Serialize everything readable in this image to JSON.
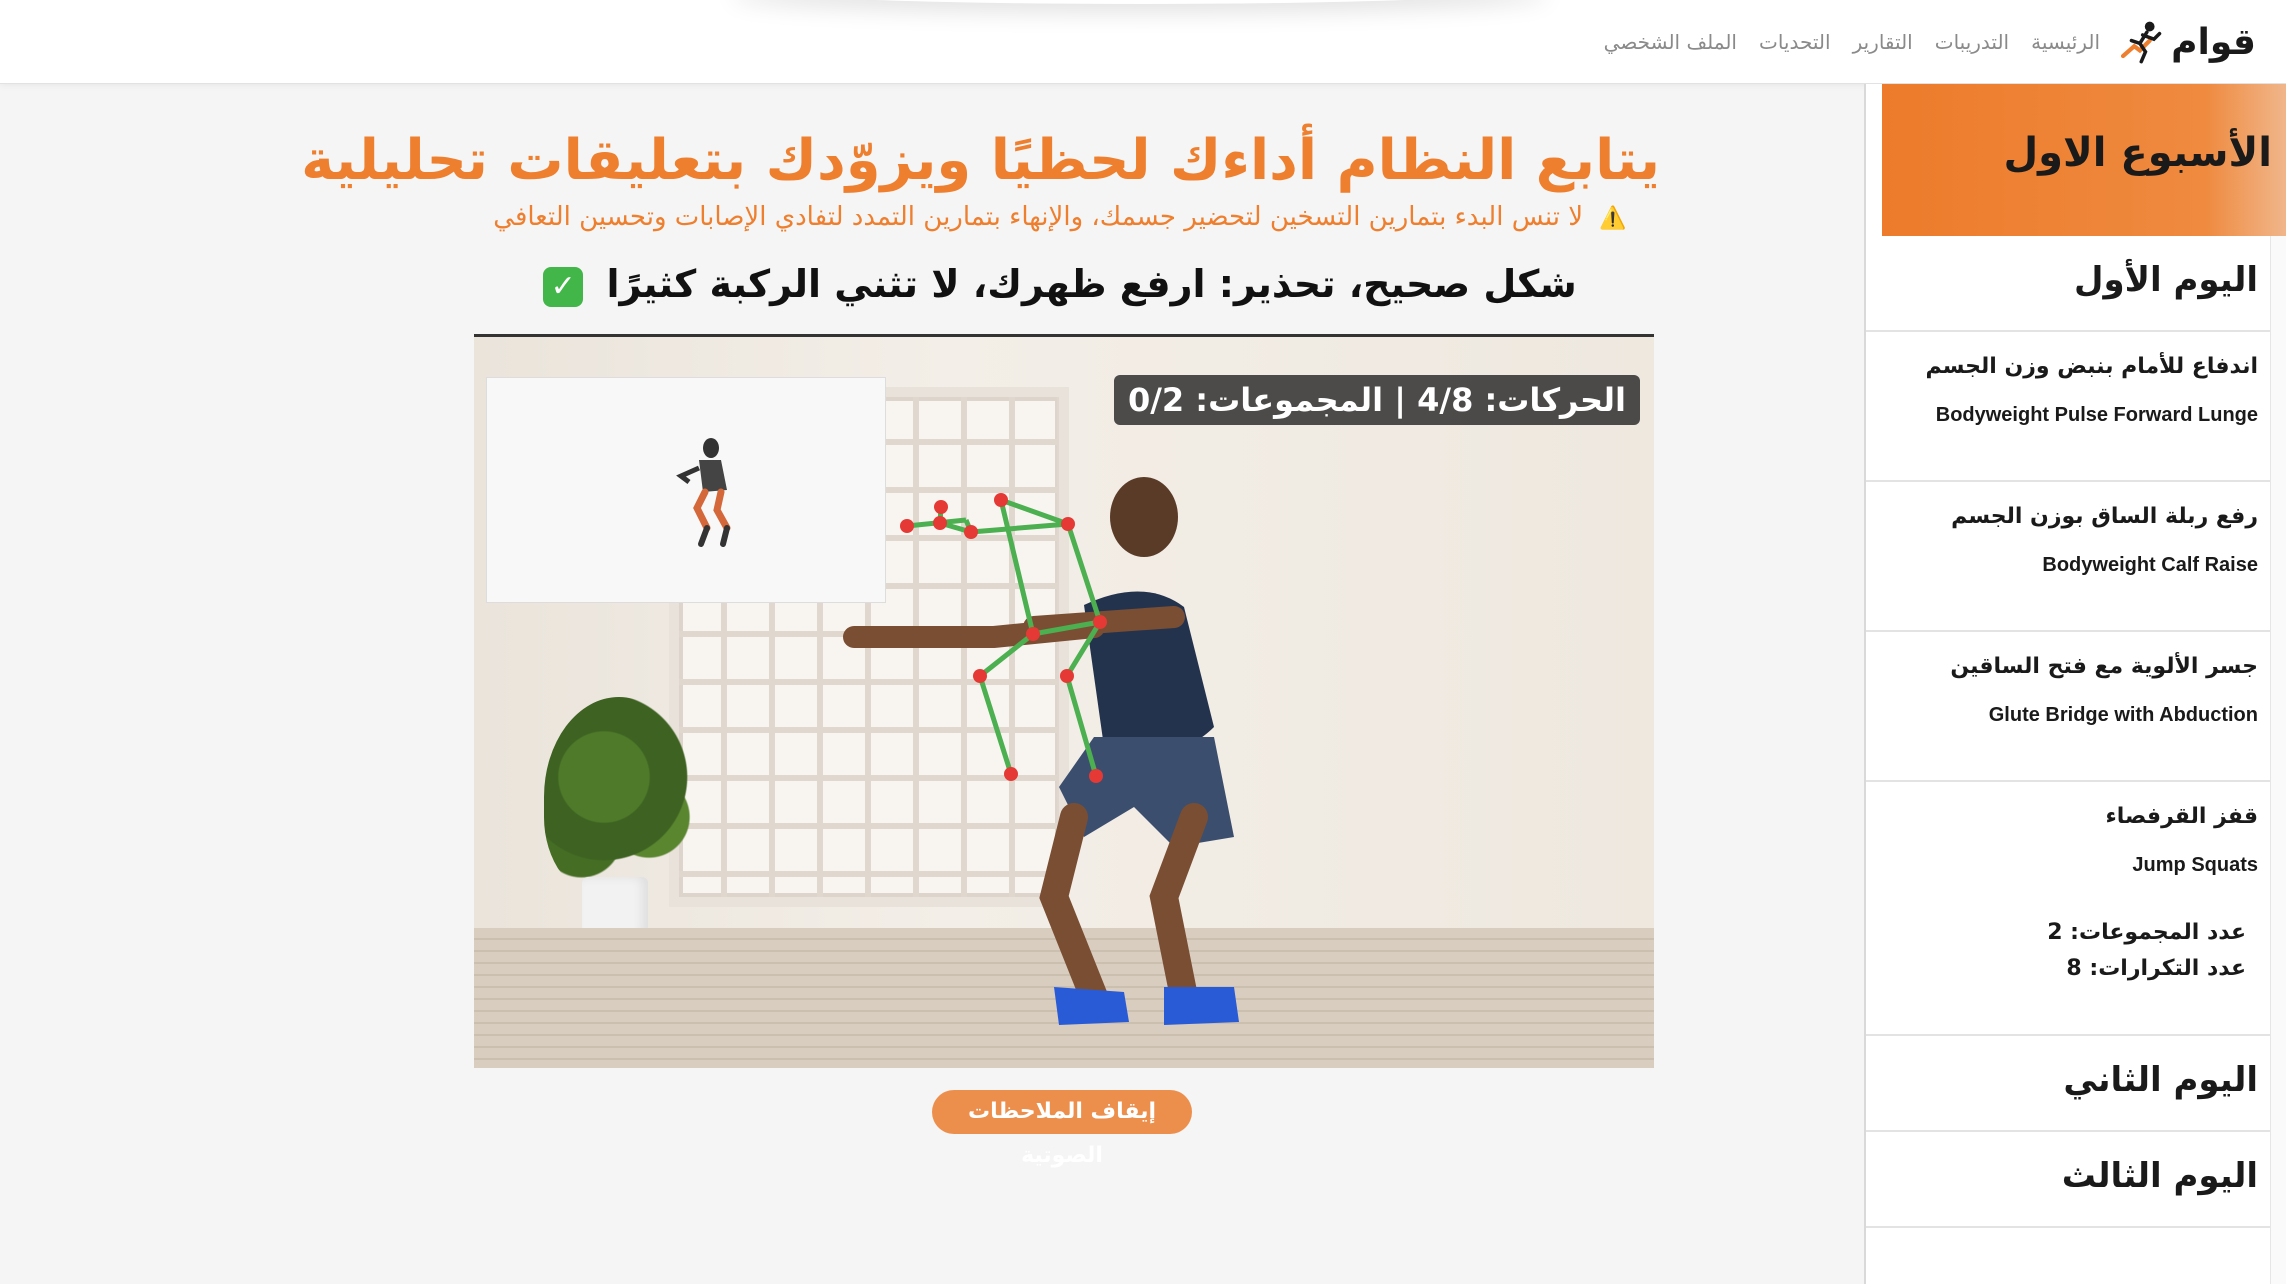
{
  "brand": {
    "name": "قوام",
    "logo_icon": "running-man-logo"
  },
  "nav": {
    "links": [
      "الرئيسية",
      "التدريبات",
      "التقارير",
      "التحديات",
      "الملف الشخصي"
    ]
  },
  "main": {
    "title": "يتابع النظام أداءك لحظيًا ويزوّدك بتعليقات تحليلية",
    "warning": "لا تنس البدء بتمارين التسخين لتحضير جسمك، والإنهاء بتمارين التمدد لتفادي الإصابات وتحسين التعافي",
    "warning_icon": "⚠️",
    "feedback": "شكل صحيح، تحذير: ارفع ظهرك، لا تثني الركبة كثيرًا",
    "feedback_icon": "✓",
    "video": {
      "counter": "الحركات: 4/8 | المجموعات: 0/2",
      "skeleton_color": "#4caf50",
      "joint_color": "#e53935"
    },
    "voice_button": "إيقاف الملاحظات الصوتية"
  },
  "sidebar": {
    "week": "الأسبوع الاول",
    "day1": "اليوم الأول",
    "exercises": [
      {
        "ar": "اندفاع للأمام بنبض وزن الجسم",
        "en": "Bodyweight Pulse Forward Lunge"
      },
      {
        "ar": "رفع ربلة الساق بوزن الجسم",
        "en": "Bodyweight Calf Raise"
      },
      {
        "ar": "جسر الألوية مع فتح الساقين",
        "en": "Glute Bridge with Abduction"
      },
      {
        "ar": "قفز القرفصاء",
        "en": "Jump Squats",
        "sets": "عدد المجموعات: 2",
        "reps": "عدد التكرارات: 8"
      }
    ],
    "day2": "اليوم الثاني",
    "day3": "اليوم الثالث"
  },
  "colors": {
    "accent": "#ee7f2e",
    "button": "#ed8f4c",
    "check": "#43b649"
  }
}
